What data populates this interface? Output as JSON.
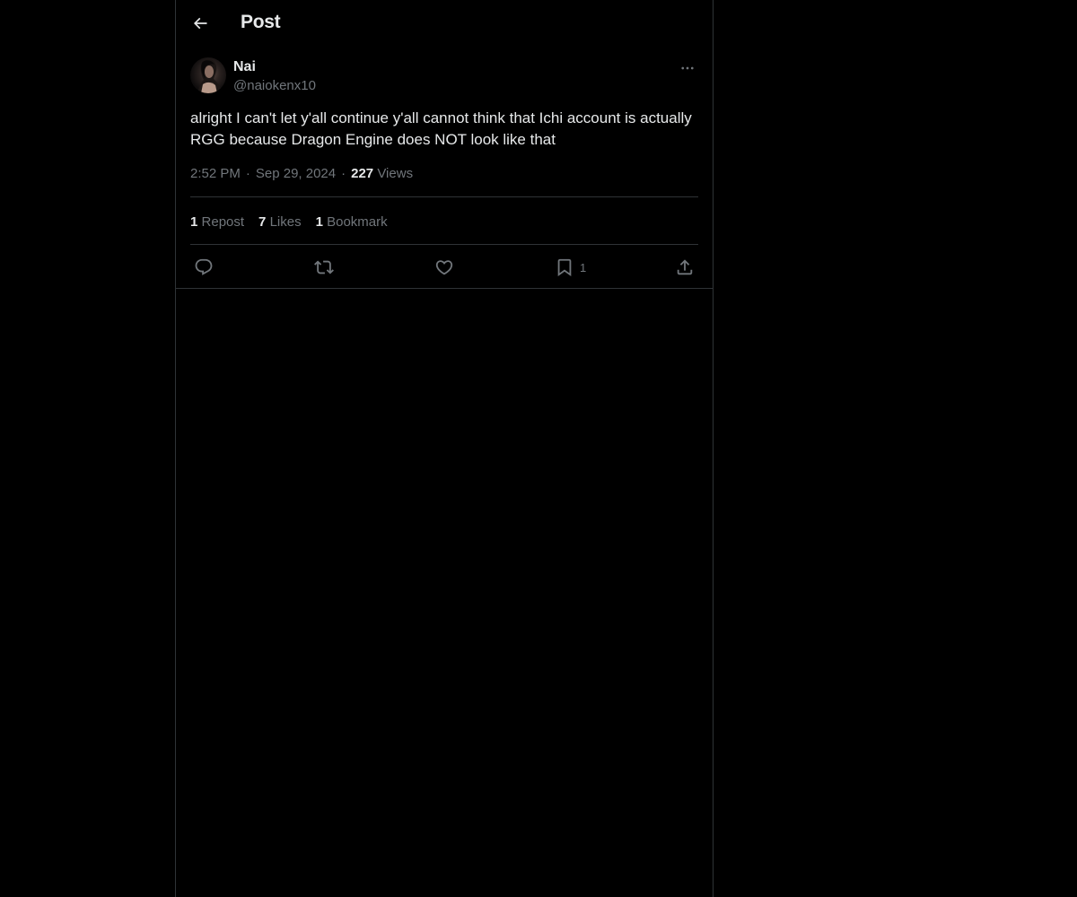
{
  "header": {
    "title": "Post",
    "back_icon": "arrow-left-icon"
  },
  "post": {
    "author": {
      "display_name": "Nai",
      "handle": "@naiokenx10"
    },
    "text": "alright I can't let y'all continue y'all cannot think that Ichi account is actually RGG because Dragon Engine does NOT look like that",
    "time": "2:52 PM",
    "date": "Sep 29, 2024",
    "separator": "·",
    "views_count": "227",
    "views_label": "Views"
  },
  "stats": {
    "reposts_count": "1",
    "reposts_label": "Repost",
    "likes_count": "7",
    "likes_label": "Likes",
    "bookmarks_count": "1",
    "bookmarks_label": "Bookmark"
  },
  "actions": {
    "reply_icon": "reply-icon",
    "repost_icon": "repost-icon",
    "like_icon": "heart-icon",
    "bookmark_icon": "bookmark-icon",
    "bookmark_count": "1",
    "share_icon": "share-icon"
  },
  "colors": {
    "background": "#000000",
    "text_primary": "#e7e9ea",
    "text_secondary": "#71767b",
    "border": "#2f3336"
  }
}
